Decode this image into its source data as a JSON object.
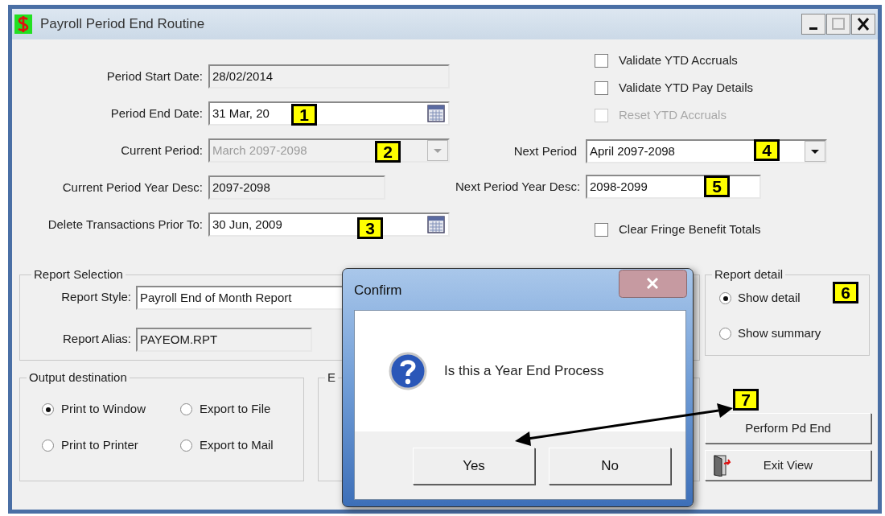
{
  "window": {
    "title": "Payroll Period End Routine"
  },
  "left_fields": [
    {
      "label": "Period Start Date:",
      "value": "28/02/2014",
      "kind": "text",
      "readonly": true,
      "disabled": false
    },
    {
      "label": "Period End Date:",
      "value": "31 Mar, 20",
      "kind": "date",
      "readonly": false,
      "disabled": false,
      "callout": "1"
    },
    {
      "label": "Current Period:",
      "value": "March 2097-2098",
      "kind": "combo",
      "readonly": true,
      "disabled": true,
      "callout": "2"
    },
    {
      "label": "Current Period Year Desc:",
      "value": "2097-2098",
      "kind": "text",
      "readonly": true,
      "disabled": false
    },
    {
      "label": "Delete Transactions Prior To:",
      "value": "30 Jun, 2009",
      "kind": "date",
      "readonly": false,
      "disabled": false,
      "callout": "3"
    }
  ],
  "options": [
    {
      "label": "Validate YTD Accruals",
      "checked": false,
      "disabled": false
    },
    {
      "label": "Validate YTD Pay Details",
      "checked": false,
      "disabled": false
    },
    {
      "label": "Reset YTD Accruals",
      "checked": false,
      "disabled": true
    }
  ],
  "right_fields": [
    {
      "label": "Next Period",
      "value": "April 2097-2098",
      "kind": "combo",
      "callout": "4"
    },
    {
      "label": "Next Period Year Desc:",
      "value": "2098-2099",
      "kind": "text",
      "callout": "5"
    }
  ],
  "clear_fringe": {
    "label": "Clear Fringe Benefit Totals",
    "checked": false,
    "disabled": false
  },
  "report_selection": {
    "title": "Report Selection",
    "style_label": "Report Style:",
    "style_value": "Payroll End of Month Report",
    "alias_label": "Report Alias:",
    "alias_value": "PAYEOM.RPT"
  },
  "output_destination": {
    "title": "Output destination",
    "options": [
      {
        "label": "Print to Window",
        "selected": true
      },
      {
        "label": "Export to File",
        "selected": false
      },
      {
        "label": "Print to Printer",
        "selected": false
      },
      {
        "label": "Export to Mail",
        "selected": false
      }
    ]
  },
  "export_group": {
    "title": "E"
  },
  "report_detail": {
    "title": "Report detail",
    "options": [
      {
        "label": "Show detail",
        "selected": true,
        "callout": "6"
      },
      {
        "label": "Show summary",
        "selected": false
      }
    ]
  },
  "buttons": [
    {
      "label": "Perform Pd End",
      "kind": "plain",
      "callout": "7"
    },
    {
      "label": "Exit View",
      "kind": "door"
    }
  ],
  "dialog": {
    "title": "Confirm",
    "message": "Is this a Year End Process",
    "buttons": [
      "Yes",
      "No"
    ]
  }
}
